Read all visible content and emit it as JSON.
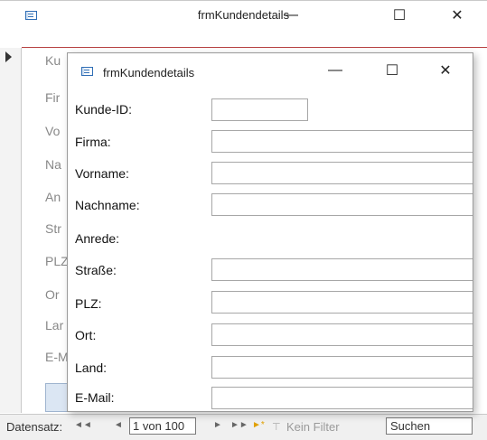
{
  "outer_window": {
    "title": "frmKundendetails",
    "minimize": "—",
    "maximize": "☐",
    "close": "✕",
    "background_labels": [
      "Ku",
      "Fir",
      "Vo",
      "Na",
      "An",
      "Str",
      "PLZ",
      "Or",
      "Lar",
      "E-M"
    ]
  },
  "inner_window": {
    "title": "frmKundendetails",
    "minimize": "—",
    "maximize": "☐",
    "close": "✕",
    "fields": [
      {
        "label": "Kunde-ID:",
        "value": ""
      },
      {
        "label": "Firma:",
        "value": ""
      },
      {
        "label": "Vorname:",
        "value": ""
      },
      {
        "label": "Nachname:",
        "value": ""
      },
      {
        "label": "Anrede:",
        "value": ""
      },
      {
        "label": "Straße:",
        "value": ""
      },
      {
        "label": "PLZ:",
        "value": ""
      },
      {
        "label": "Ort:",
        "value": ""
      },
      {
        "label": "Land:",
        "value": ""
      },
      {
        "label": "E-Mail:",
        "value": ""
      }
    ]
  },
  "navigation": {
    "label": "Datensatz:",
    "first": "◄◄",
    "prev": "◄",
    "position": "1 von 100",
    "next": "►",
    "last": "►►",
    "new": "►*",
    "filter_label": "Kein Filter",
    "search_label": "Suchen"
  },
  "icons": {
    "app_icon": "form-icon",
    "record_selector": "record-selector-arrow-icon",
    "filter_icon": "filter-icon"
  },
  "colors": {
    "title_separator": "#b84545",
    "app_icon": "#2e6db5"
  }
}
